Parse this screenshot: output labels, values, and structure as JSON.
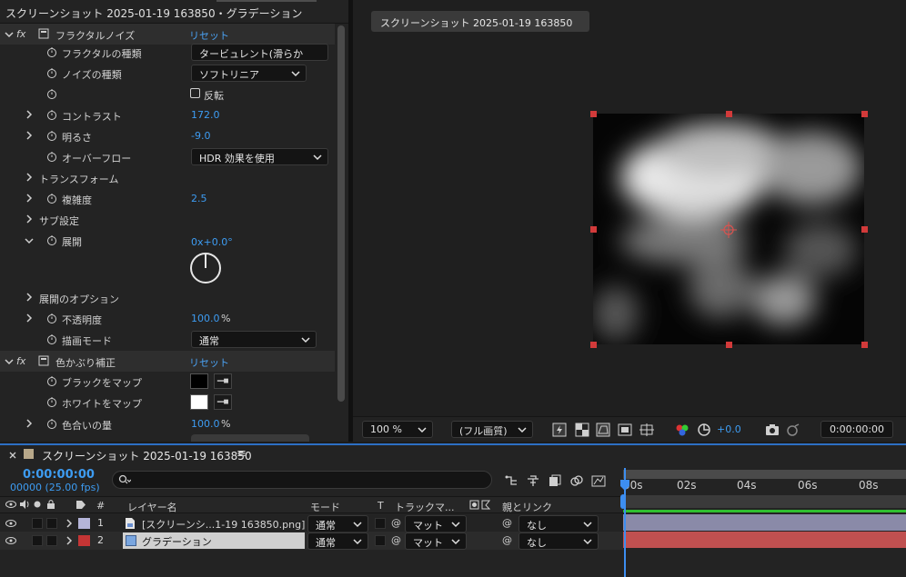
{
  "effect_controls": {
    "title": "スクリーンショット 2025-01-19 163850・グラデーション",
    "effects": [
      {
        "name": "フラクタルノイズ",
        "reset_label": "リセット",
        "params": [
          {
            "label": "フラクタルの種類",
            "dropdown": "タービュレント(滑らか"
          },
          {
            "label": "ノイズの種類",
            "dropdown": "ソフトリニア"
          },
          {
            "label": "",
            "checkbox_label": "反転"
          },
          {
            "label": "コントラスト",
            "value": "172.0"
          },
          {
            "label": "明るさ",
            "value": "-9.0"
          },
          {
            "label": "オーバーフロー",
            "dropdown": "HDR 効果を使用"
          },
          {
            "label": "トランスフォーム"
          },
          {
            "label": "複雑度",
            "value": "2.5"
          },
          {
            "label": "サブ設定"
          },
          {
            "label": "展開",
            "value": "0x+0.0°"
          },
          {
            "label": "展開のオプション"
          },
          {
            "label": "不透明度",
            "value": "100.0",
            "unit": "%"
          },
          {
            "label": "描画モード",
            "dropdown": "通常"
          }
        ]
      },
      {
        "name": "色かぶり補正",
        "reset_label": "リセット",
        "params": [
          {
            "label": "ブラックをマップ",
            "color": "#000000"
          },
          {
            "label": "ホワイトをマップ",
            "color": "#ffffff"
          },
          {
            "label": "色合いの量",
            "value": "100.0",
            "unit": "%"
          }
        ]
      }
    ]
  },
  "viewer": {
    "tab_label": "スクリーンショット 2025-01-19 163850",
    "toolbar": {
      "zoom": "100 %",
      "resolution": "(フル画質)",
      "exposure": "+0.0",
      "timecode": "0:00:00:00"
    }
  },
  "timeline": {
    "comp_name": "スクリーンショット 2025-01-19 163850",
    "current_time": "0:00:00:00",
    "fps": "00000 (25.00 fps)",
    "search_placeholder": "",
    "columns": {
      "number": "#",
      "layer_name": "レイヤー名",
      "mode": "モード",
      "t": "T",
      "track_matte": "トラックマ...",
      "parent": "親とリンク"
    },
    "layers": [
      {
        "number": "1",
        "name": "[スクリーンシ...1-19 163850.png]",
        "mode": "通常",
        "matte": "マット",
        "parent": "なし",
        "label_color": "#b4b4d8"
      },
      {
        "number": "2",
        "name": "グラデーション",
        "mode": "通常",
        "matte": "マット",
        "parent": "なし",
        "label_color": "#c53535"
      }
    ],
    "ruler_ticks": [
      "00s",
      "02s",
      "04s",
      "06s",
      "08s"
    ]
  },
  "colors": {
    "accent_blue": "#3d9cf2",
    "handle_red": "#d23a3a",
    "layer1_bar": "#8a8aa8",
    "layer2_bar": "#c05050"
  }
}
